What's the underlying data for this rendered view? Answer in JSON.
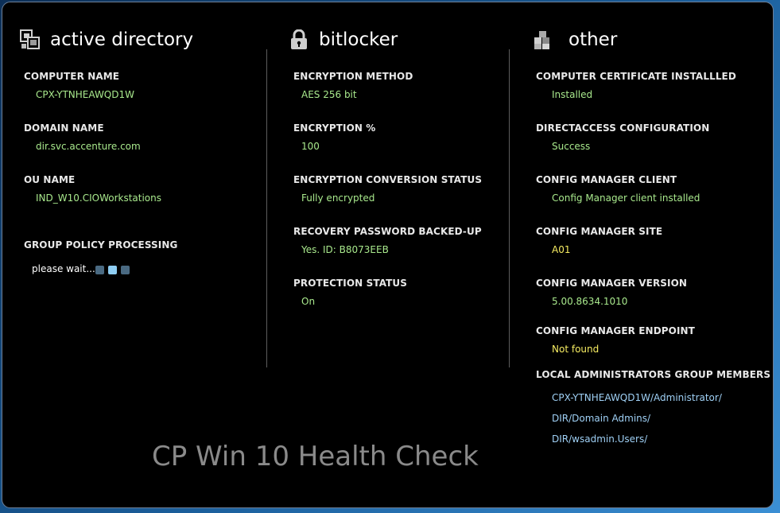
{
  "active_directory": {
    "title": "active directory",
    "icon": "active-directory-icon",
    "computer_name_label": "COMPUTER NAME",
    "computer_name": "CPX-YTNHEAWQD1W",
    "domain_name_label": "DOMAIN NAME",
    "domain_name": "dir.svc.accenture.com",
    "ou_name_label": "OU NAME",
    "ou_name": "IND_W10.CIOWorkstations",
    "gpo_label": "GROUP POLICY PROCESSING",
    "gpo_status": "please wait..."
  },
  "bitlocker": {
    "title": "bitlocker",
    "icon": "lock-icon",
    "method_label": "ENCRYPTION METHOD",
    "method": "AES 256 bit",
    "percent_label": "ENCRYPTION %",
    "percent": "100",
    "conversion_label": "ENCRYPTION CONVERSION STATUS",
    "conversion": "Fully encrypted",
    "recovery_label": "RECOVERY PASSWORD BACKED-UP",
    "recovery": "Yes.  ID: B8073EEB",
    "protection_label": "PROTECTION STATUS",
    "protection": "On"
  },
  "other": {
    "title": "other",
    "icon": "boxes-icon",
    "cert_label": "COMPUTER CERTIFICATE INSTALLLED",
    "cert": "Installed",
    "directaccess_label": "DIRECTACCESS CONFIGURATION",
    "directaccess": "Success",
    "cm_client_label": "CONFIG MANAGER CLIENT",
    "cm_client": "Config Manager client installed",
    "cm_site_label": "CONFIG MANAGER SITE",
    "cm_site": "A01",
    "cm_version_label": "CONFIG MANAGER VERSION",
    "cm_version": "5.00.8634.1010",
    "cm_endpoint_label": "CONFIG MANAGER ENDPOINT",
    "cm_endpoint": "Not found",
    "admins_label": "LOCAL ADMINISTRATORS GROUP MEMBERS",
    "admins": [
      "CPX-YTNHEAWQD1W/Administrator/",
      "DIR/Domain Admins/",
      "DIR/wsadmin.Users/"
    ]
  },
  "footer": {
    "title": "CP Win 10 Health Check"
  },
  "colors": {
    "ok": "#a8e88c",
    "warn": "#f6ec62",
    "info": "#9fd0f5"
  }
}
